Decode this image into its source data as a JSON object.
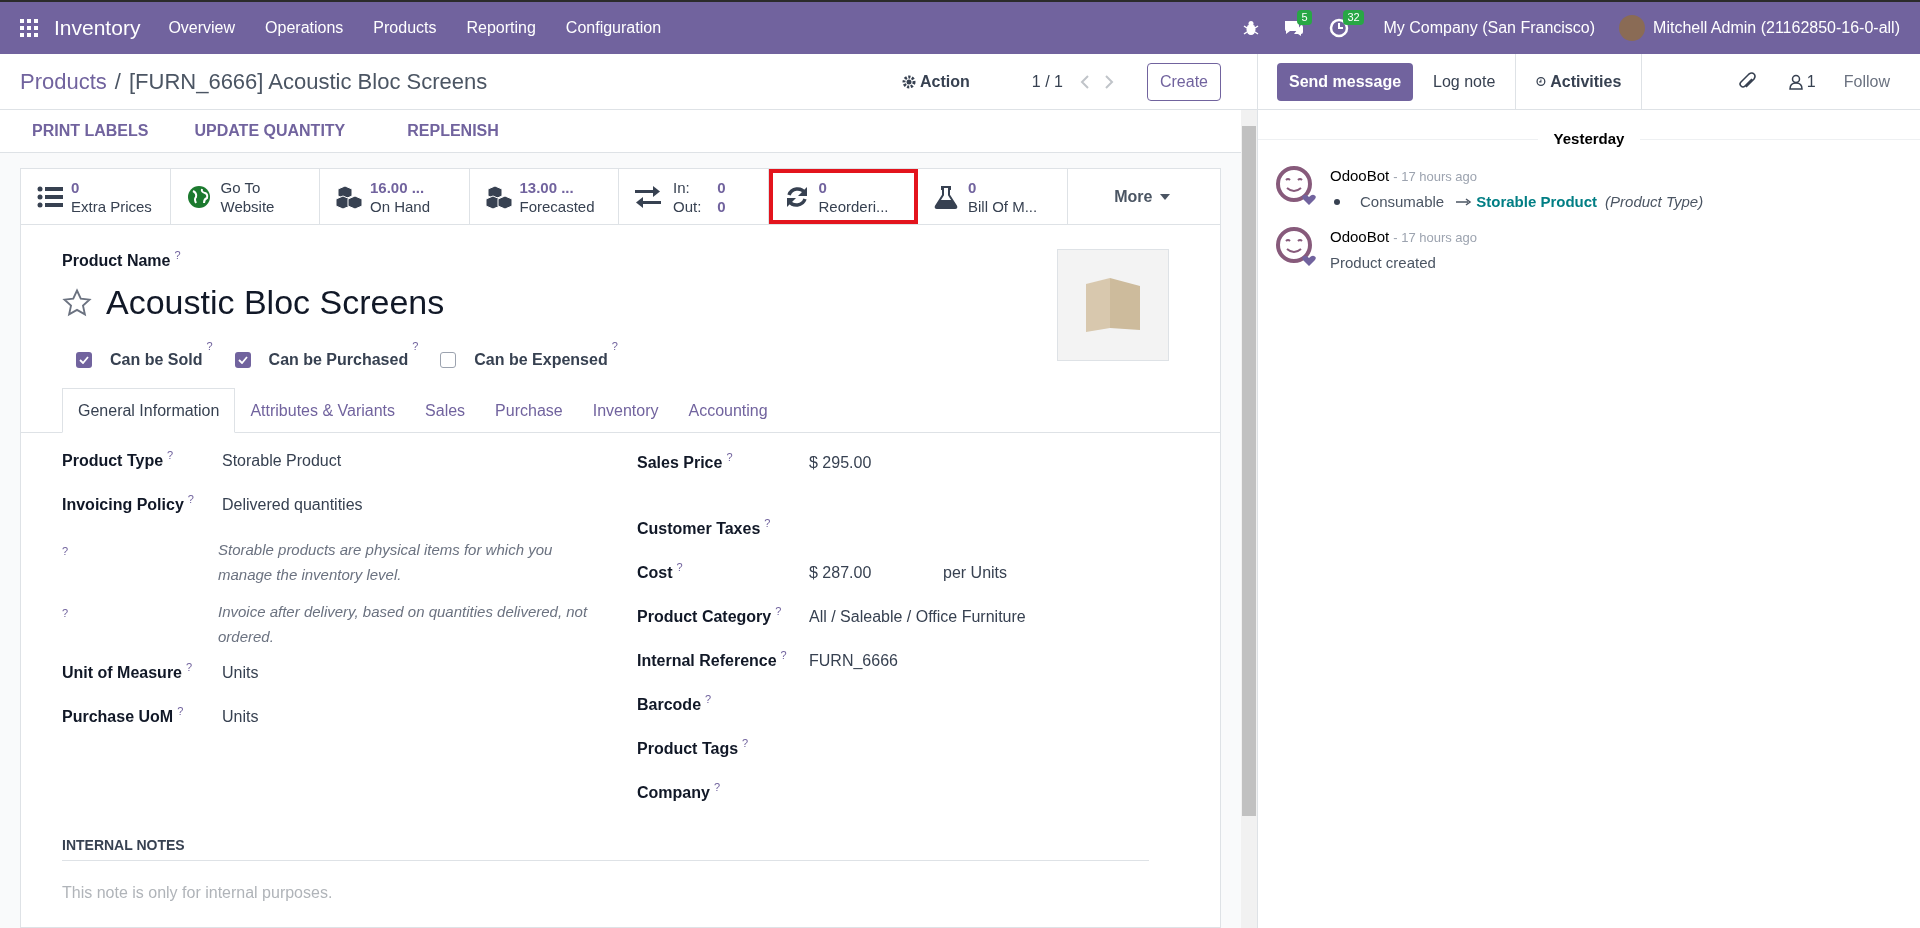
{
  "navbar": {
    "app": "Inventory",
    "menus": [
      "Overview",
      "Operations",
      "Products",
      "Reporting",
      "Configuration"
    ],
    "messages_count": "5",
    "activities_count": "32",
    "company": "My Company (San Francisco)",
    "user": "Mitchell Admin (21162850-16-0-all)"
  },
  "breadcrumb": {
    "parent": "Products",
    "separator": "/",
    "current": "[FURN_6666] Acoustic Bloc Screens"
  },
  "control": {
    "action": "Action",
    "pager": "1 / 1",
    "create": "Create"
  },
  "header_buttons": [
    "PRINT LABELS",
    "UPDATE QUANTITY",
    "REPLENISH"
  ],
  "smart_buttons": [
    {
      "kind": "stat",
      "value": "0",
      "label": "Extra Prices",
      "highlighted": false
    },
    {
      "kind": "link",
      "value": "Go To",
      "label": "Website",
      "highlighted": false
    },
    {
      "kind": "stat",
      "value": "16.00 ...",
      "label": "On Hand",
      "highlighted": false
    },
    {
      "kind": "stat",
      "value": "13.00 ...",
      "label": "Forecasted",
      "highlighted": false
    },
    {
      "kind": "inout",
      "in_label": "In:",
      "in_value": "0",
      "out_label": "Out:",
      "out_value": "0",
      "highlighted": false
    },
    {
      "kind": "stat",
      "value": "0",
      "label": "Reorderi...",
      "highlighted": true
    },
    {
      "kind": "stat",
      "value": "0",
      "label": "Bill Of M...",
      "highlighted": false
    },
    {
      "kind": "more",
      "label": "More",
      "highlighted": false
    }
  ],
  "product": {
    "name_label": "Product Name",
    "help_mark": "?",
    "name": "Acoustic Bloc Screens",
    "favorite": false
  },
  "options": [
    {
      "label": "Can be Sold",
      "checked": true
    },
    {
      "label": "Can be Purchased",
      "checked": true
    },
    {
      "label": "Can be Expensed",
      "checked": false
    }
  ],
  "tabs": [
    {
      "label": "General Information",
      "selected": true
    },
    {
      "label": "Attributes & Variants",
      "selected": false
    },
    {
      "label": "Sales",
      "selected": false
    },
    {
      "label": "Purchase",
      "selected": false
    },
    {
      "label": "Inventory",
      "selected": false
    },
    {
      "label": "Accounting",
      "selected": false
    }
  ],
  "left_fields": [
    {
      "kind": "field",
      "label": "Product Type",
      "value": "Storable Product"
    },
    {
      "kind": "field",
      "label": "Invoicing Policy",
      "value": "Delivered quantities"
    },
    {
      "kind": "help",
      "text": "Storable products are physical items for which you manage the inventory level."
    },
    {
      "kind": "help",
      "text": "Invoice after delivery, based on quantities delivered, not ordered."
    },
    {
      "kind": "field",
      "label": "Unit of Measure",
      "value": "Units"
    },
    {
      "kind": "field",
      "label": "Purchase UoM",
      "value": "Units"
    }
  ],
  "right_fields": [
    {
      "label": "Sales Price",
      "value": "$ 295.00"
    },
    {
      "label": "Customer Taxes"
    },
    {
      "label": "Cost",
      "value": "$ 287.00",
      "suffix": "per Units"
    },
    {
      "label": "Product Category",
      "value": "All / Saleable / Office Furniture"
    },
    {
      "label": "Internal Reference",
      "value": "FURN_6666"
    },
    {
      "label": "Barcode"
    },
    {
      "label": "Product Tags"
    },
    {
      "label": "Company"
    }
  ],
  "internal_notes": {
    "title": "INTERNAL NOTES",
    "placeholder": "This note is only for internal purposes."
  },
  "chatter": {
    "send": "Send message",
    "log": "Log note",
    "activities": "Activities",
    "followers": "1",
    "follow": "Follow",
    "date": "Yesterday",
    "messages": [
      {
        "kind": "tracking",
        "author": "OdooBot",
        "time": "- 17 hours ago",
        "old": "Consumable",
        "new": "Storable Product",
        "field": "(Product Type)"
      },
      {
        "kind": "text",
        "author": "OdooBot",
        "time": "- 17 hours ago",
        "body": "Product created"
      }
    ]
  }
}
